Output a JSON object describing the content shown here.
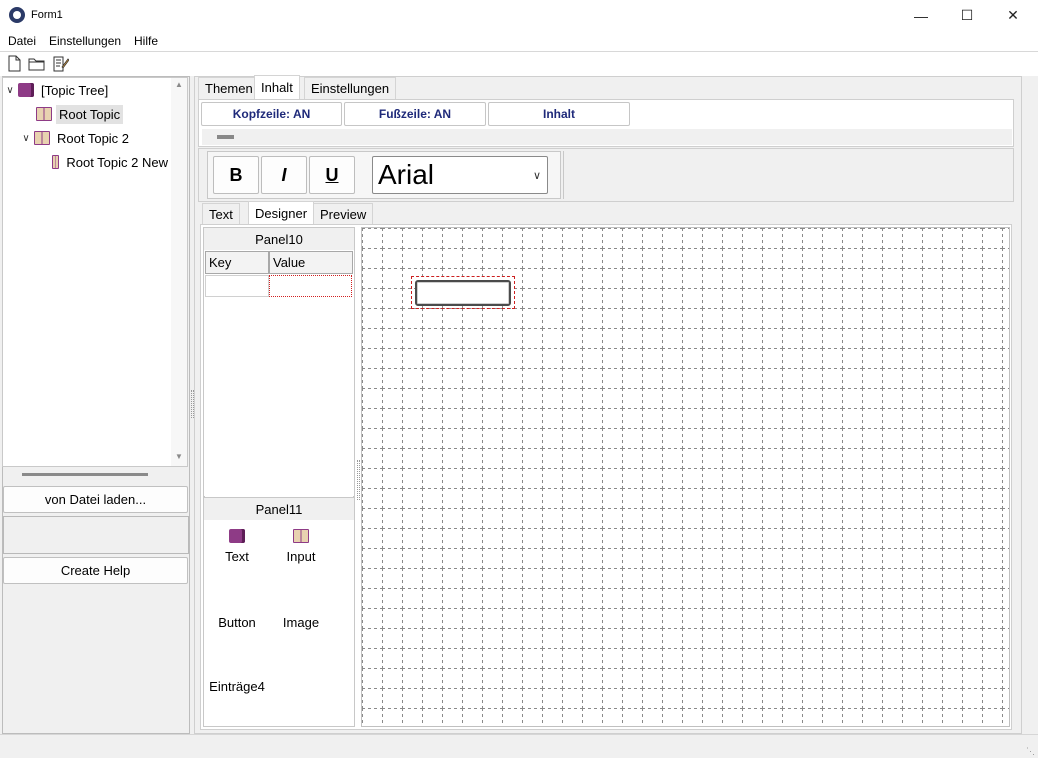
{
  "window": {
    "title": "Form1",
    "controls": [
      "minimize",
      "maximize",
      "close"
    ]
  },
  "menu": {
    "items": [
      "Datei",
      "Einstellungen",
      "Hilfe"
    ]
  },
  "toolbar": {
    "icons": [
      "new-file-icon",
      "open-folder-icon",
      "edit-note-icon"
    ]
  },
  "tree": {
    "root": "[Topic Tree]",
    "nodes": [
      {
        "label": "Root Topic",
        "selected": true
      },
      {
        "label": "Root Topic 2",
        "expanded": true
      },
      {
        "label": "Root Topic 2 New"
      }
    ]
  },
  "left_buttons": {
    "load": "von Datei laden...",
    "create": "Create Help"
  },
  "main_tabs": [
    "Themen",
    "Inhalt",
    "Einstellungen"
  ],
  "main_tab_active": "Inhalt",
  "header_buttons": [
    "Kopfzeile: AN",
    "Fußzeile: AN",
    "Inhalt"
  ],
  "format": {
    "bold": "B",
    "italic": "I",
    "underline": "U",
    "font": "Arial"
  },
  "inner_tabs": [
    "Text",
    "Designer",
    "Preview"
  ],
  "inner_tab_active": "Designer",
  "panel10": {
    "title": "Panel10",
    "columns": [
      "Key",
      "Value"
    ]
  },
  "panel11": {
    "title": "Panel11",
    "tools": [
      "Text",
      "Input",
      "Button",
      "Image",
      "Einträge4"
    ]
  },
  "colors": {
    "accent_text": "#1f2a7a",
    "book": "#8e3b86",
    "selection_dash": "#cc2020"
  }
}
